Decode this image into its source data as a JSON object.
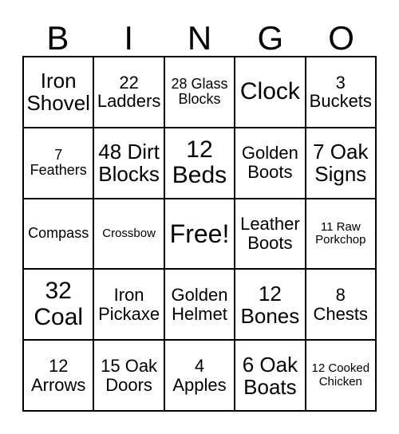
{
  "card": {
    "title": "BINGO",
    "headers": [
      "B",
      "I",
      "N",
      "G",
      "O"
    ],
    "free_space_label": "Free!",
    "colors": {
      "background": "#ffffff",
      "border": "#000000",
      "text": "#000000"
    },
    "grid_size": "5x5",
    "rows": [
      [
        {
          "text": "Iron Shovel",
          "size": "lg"
        },
        {
          "text": "22 Ladders",
          "size": "md"
        },
        {
          "text": "28 Glass Blocks",
          "size": "sm"
        },
        {
          "text": "Clock",
          "size": "xl"
        },
        {
          "text": "3 Buckets",
          "size": "md"
        }
      ],
      [
        {
          "text": "7 Feathers",
          "size": "sm"
        },
        {
          "text": "48 Dirt Blocks",
          "size": "lg"
        },
        {
          "text": "12 Beds",
          "size": "xl"
        },
        {
          "text": "Golden Boots",
          "size": "md"
        },
        {
          "text": "7 Oak Signs",
          "size": "lg"
        }
      ],
      [
        {
          "text": "Compass",
          "size": "sm"
        },
        {
          "text": "Crossbow",
          "size": "xs"
        },
        {
          "text": "Free!",
          "size": "free"
        },
        {
          "text": "Leather Boots",
          "size": "md"
        },
        {
          "text": "11 Raw Porkchop",
          "size": "xs"
        }
      ],
      [
        {
          "text": "32 Coal",
          "size": "xl"
        },
        {
          "text": "Iron Pickaxe",
          "size": "md"
        },
        {
          "text": "Golden Helmet",
          "size": "md"
        },
        {
          "text": "12 Bones",
          "size": "lg"
        },
        {
          "text": "8 Chests",
          "size": "md"
        }
      ],
      [
        {
          "text": "12 Arrows",
          "size": "md"
        },
        {
          "text": "15 Oak Doors",
          "size": "md"
        },
        {
          "text": "4 Apples",
          "size": "md"
        },
        {
          "text": "6 Oak Boats",
          "size": "lg"
        },
        {
          "text": "12 Cooked Chicken",
          "size": "xs"
        }
      ]
    ]
  }
}
